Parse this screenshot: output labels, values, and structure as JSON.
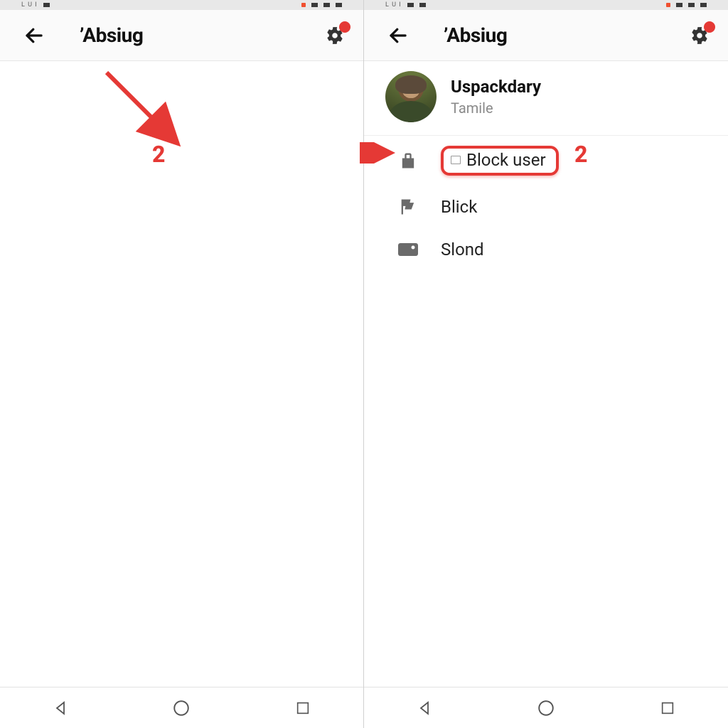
{
  "annotation_color": "#e53935",
  "left": {
    "header_title": "’Absiug",
    "step_number": "2"
  },
  "right": {
    "header_title": "’Absiug",
    "profile": {
      "name": "Uspackdary",
      "subtitle": "Tamile"
    },
    "menu": [
      {
        "label": "Block user",
        "highlighted": true
      },
      {
        "label": "Blick"
      },
      {
        "label": "Slond"
      }
    ],
    "step_number": "2"
  }
}
